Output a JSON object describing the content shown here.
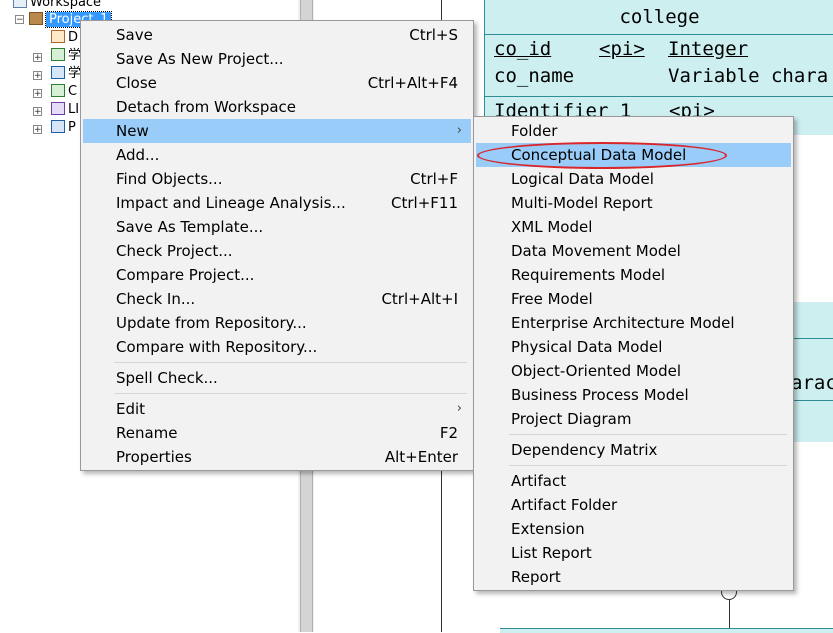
{
  "tree": {
    "workspace_label": "Workspace",
    "project_label": "Project_1",
    "children": [
      {
        "label": "D"
      },
      {
        "label": "学"
      },
      {
        "label": "学"
      },
      {
        "label": "C"
      },
      {
        "label": "LI"
      },
      {
        "label": "P"
      }
    ]
  },
  "diagram": {
    "entity_title": "college",
    "attributes": [
      {
        "name": "co_id",
        "key": "<pi>",
        "type": "Integer"
      },
      {
        "name": "co_name",
        "key": "",
        "type": "Variable chara"
      }
    ],
    "identifier": {
      "name": "Identifier_1",
      "key": "<pi>"
    },
    "partial_text": "arac"
  },
  "context_menu": {
    "items": [
      {
        "label": "Save",
        "shortcut": "Ctrl+S"
      },
      {
        "label": "Save As New Project...",
        "shortcut": ""
      },
      {
        "label": "Close",
        "shortcut": "Ctrl+Alt+F4"
      },
      {
        "label": "Detach from Workspace",
        "shortcut": ""
      },
      {
        "label": "New",
        "shortcut": "",
        "submenu": true,
        "highlighted": true
      },
      {
        "label": "Add...",
        "shortcut": ""
      },
      {
        "label": "Find Objects...",
        "shortcut": "Ctrl+F"
      },
      {
        "label": "Impact and Lineage Analysis...",
        "shortcut": "Ctrl+F11"
      },
      {
        "label": "Save As Template...",
        "shortcut": ""
      },
      {
        "label": "Check Project...",
        "shortcut": ""
      },
      {
        "label": "Compare Project...",
        "shortcut": ""
      },
      {
        "label": "Check In...",
        "shortcut": "Ctrl+Alt+I"
      },
      {
        "label": "Update from Repository...",
        "shortcut": ""
      },
      {
        "label": "Compare with Repository...",
        "shortcut": ""
      },
      {
        "label": "Spell Check...",
        "shortcut": ""
      },
      {
        "label": "Edit",
        "shortcut": "",
        "submenu": true
      },
      {
        "label": "Rename",
        "shortcut": "F2"
      },
      {
        "label": "Properties",
        "shortcut": "Alt+Enter"
      }
    ]
  },
  "new_submenu": {
    "items": [
      {
        "label": "Folder"
      },
      {
        "label": "Conceptual Data Model",
        "highlighted": true
      },
      {
        "label": "Logical Data Model"
      },
      {
        "label": "Multi-Model Report"
      },
      {
        "label": "XML Model"
      },
      {
        "label": "Data Movement Model"
      },
      {
        "label": "Requirements Model"
      },
      {
        "label": "Free Model"
      },
      {
        "label": "Enterprise Architecture Model"
      },
      {
        "label": "Physical Data Model"
      },
      {
        "label": "Object-Oriented Model"
      },
      {
        "label": "Business Process Model"
      },
      {
        "label": "Project Diagram"
      },
      {
        "label": "Dependency Matrix"
      },
      {
        "label": "Artifact"
      },
      {
        "label": "Artifact Folder"
      },
      {
        "label": "Extension"
      },
      {
        "label": "List Report"
      },
      {
        "label": "Report"
      }
    ]
  },
  "colors": {
    "highlight": "#99ccf8",
    "entity_fill": "#cdeff0",
    "annotation_oval": "#d9262b"
  }
}
